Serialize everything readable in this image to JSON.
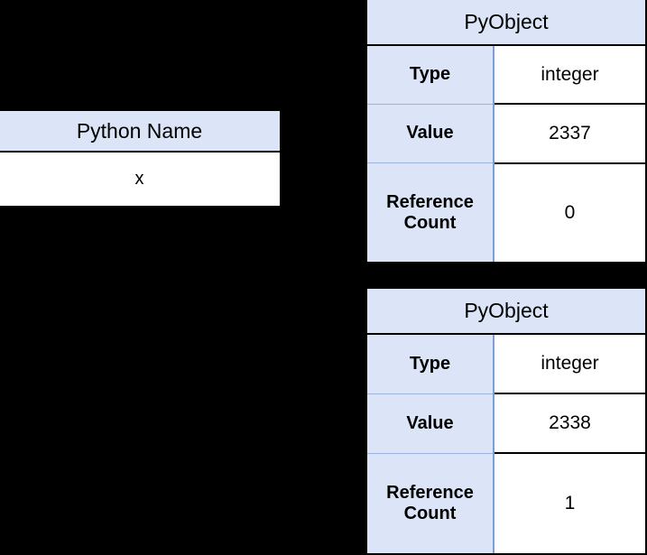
{
  "diagram": {
    "background_color": "#000000",
    "header_color": "#dbe5f7",
    "cell_color": "#ffffff",
    "border_color": "#000000",
    "accent_border_color": "#7b9fd4"
  },
  "python_name_table": {
    "header": "Python Name",
    "value": "x"
  },
  "pyobject_tables": [
    {
      "header": "PyObject",
      "rows": [
        {
          "label": "Type",
          "value": "integer"
        },
        {
          "label": "Value",
          "value": "2337"
        },
        {
          "label": "Reference Count",
          "value": "0"
        }
      ]
    },
    {
      "header": "PyObject",
      "rows": [
        {
          "label": "Type",
          "value": "integer"
        },
        {
          "label": "Value",
          "value": "2338"
        },
        {
          "label": "Reference Count",
          "value": "1"
        }
      ]
    }
  ]
}
